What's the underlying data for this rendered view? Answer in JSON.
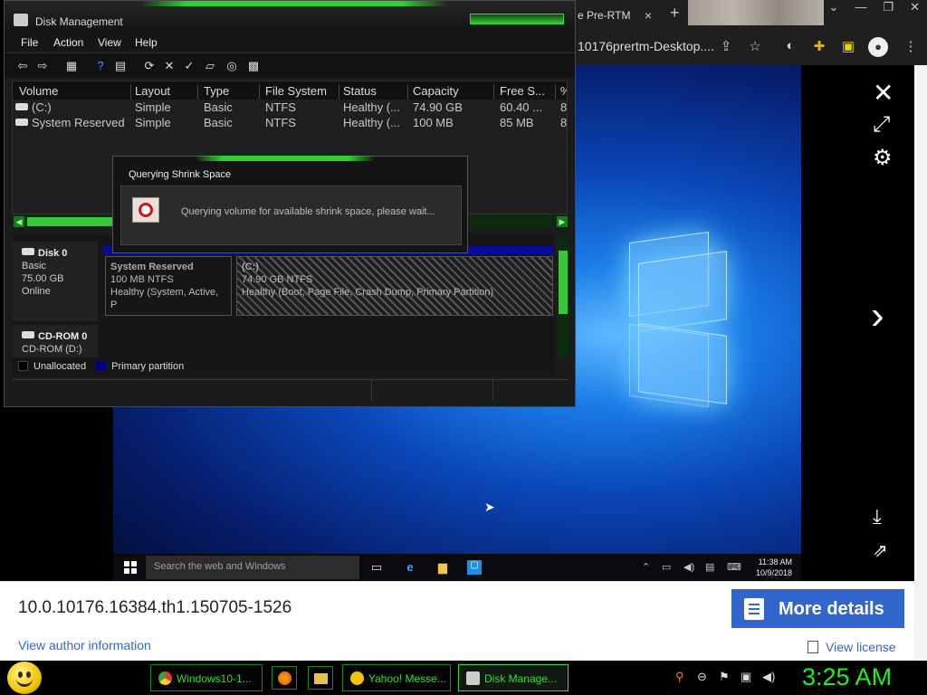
{
  "browser": {
    "tab_title": "e Pre-RTM",
    "url_fragment": "10176prertm-Desktop....",
    "profile_initial": "",
    "tab_close": "×",
    "new_tab": "+"
  },
  "disk_management": {
    "title": "Disk Management",
    "menu": [
      "File",
      "Action",
      "View",
      "Help"
    ],
    "columns": [
      "Volume",
      "Layout",
      "Type",
      "File System",
      "Status",
      "Capacity",
      "Free S...",
      "%"
    ],
    "volumes": [
      {
        "volume": "(C:)",
        "layout": "Simple",
        "type": "Basic",
        "fs": "NTFS",
        "status": "Healthy (...",
        "capacity": "74.90 GB",
        "free": "60.40 ...",
        "pct": "8"
      },
      {
        "volume": "System Reserved",
        "layout": "Simple",
        "type": "Basic",
        "fs": "NTFS",
        "status": "Healthy (...",
        "capacity": "100 MB",
        "free": "85 MB",
        "pct": "8"
      }
    ],
    "disk0": {
      "name": "Disk 0",
      "kind": "Basic",
      "size": "75.00 GB",
      "state": "Online"
    },
    "partitions": [
      {
        "name": "System Reserved",
        "size": "100 MB NTFS",
        "status": "Healthy (System, Active, P"
      },
      {
        "name": "(C:)",
        "size": "74.90 GB NTFS",
        "status": "Healthy (Boot, Page File, Crash Dump, Primary Partition)"
      }
    ],
    "cdrom": {
      "name": "CD-ROM 0",
      "label": "CD-ROM (D:)"
    },
    "legend": {
      "unallocated": "Unallocated",
      "primary": "Primary partition"
    }
  },
  "dialog": {
    "title": "Querying Shrink Space",
    "message": "Querying volume for available shrink space, please wait..."
  },
  "win10": {
    "search_placeholder": "Search the web and Windows",
    "time": "11:38 AM",
    "date": "10/9/2018"
  },
  "info": {
    "build": "10.0.10176.16384.th1.150705-1526",
    "more_details": "More details",
    "author_link": "View author information",
    "license_link": "View license"
  },
  "taskbar": {
    "buttons": [
      "Windows10-1...",
      "Yahoo! Messe...",
      "Disk Manage..."
    ],
    "clock": "3:25 AM"
  },
  "colors": {
    "accent_green": "#2ed12e",
    "link_blue": "#3366cc",
    "primary_partition": "#00008b"
  }
}
